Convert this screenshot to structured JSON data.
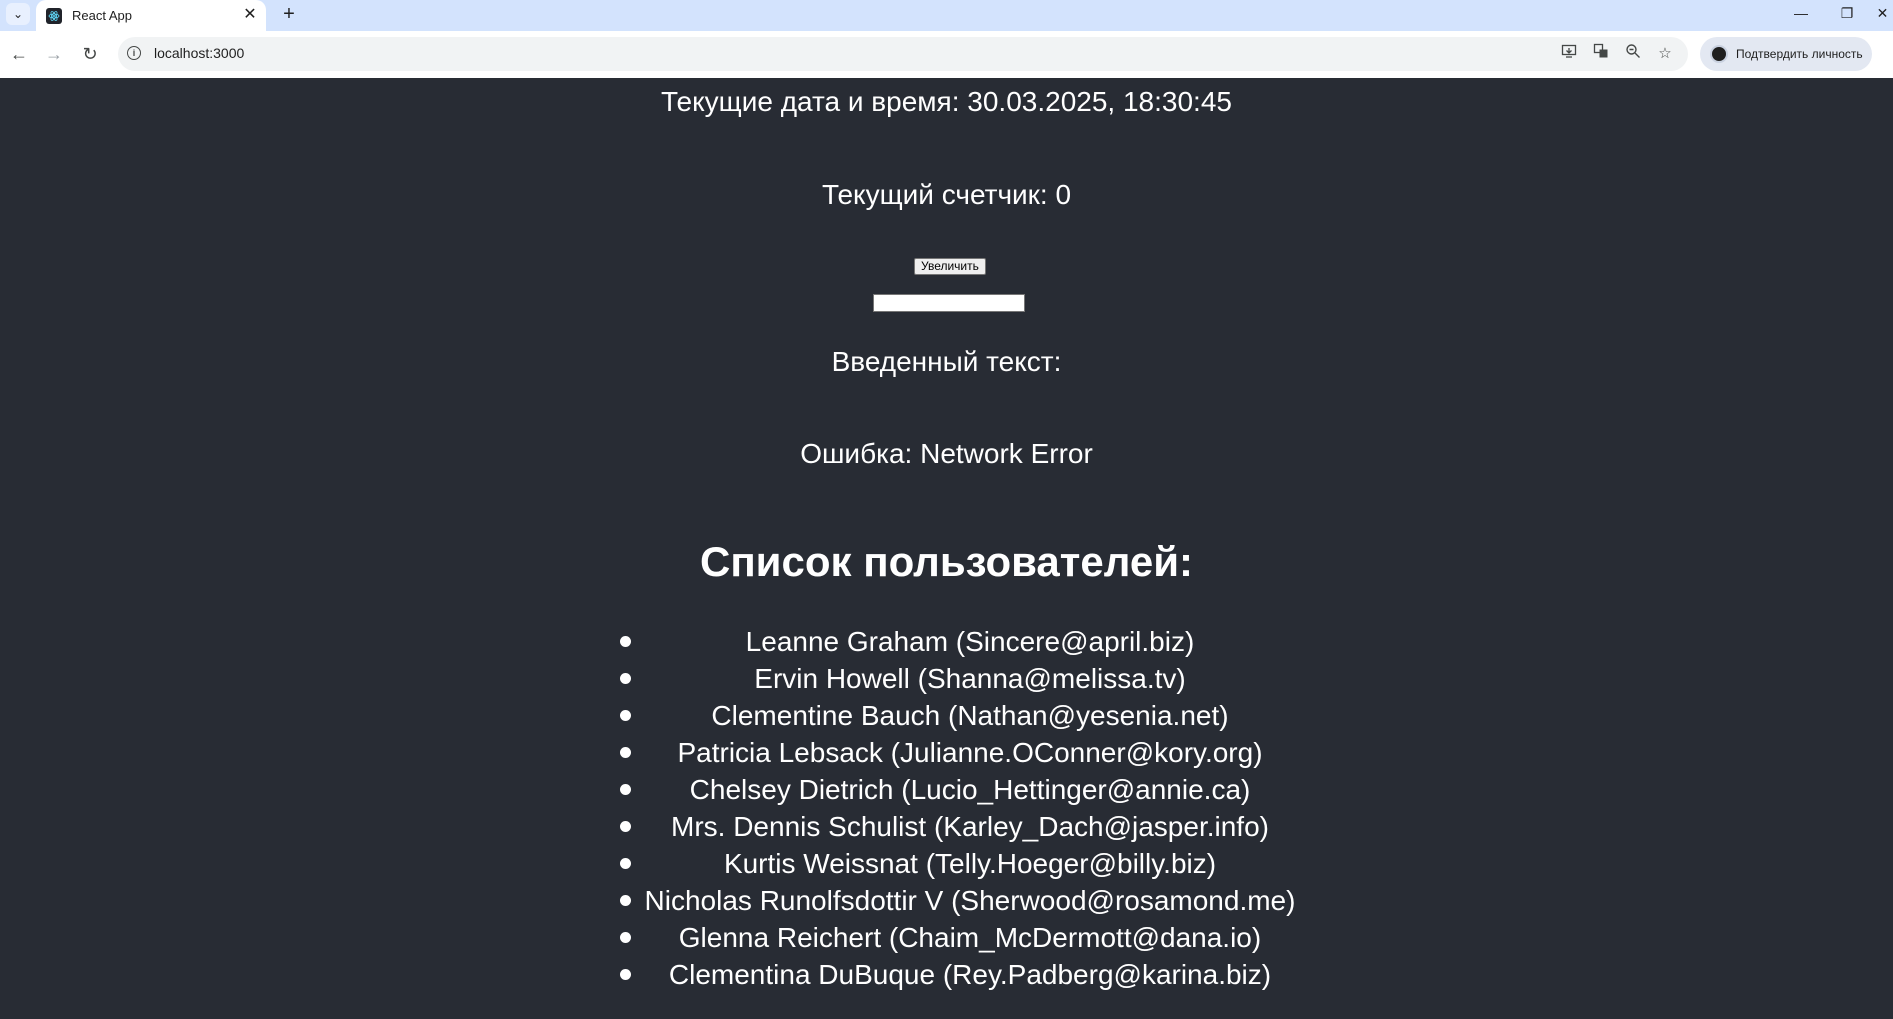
{
  "browser": {
    "tab_title": "React App",
    "tab_close": "✕",
    "new_tab": "+",
    "tab_list": "⌄",
    "window_minimize": "—",
    "window_restore": "❐",
    "window_close": "✕",
    "back": "←",
    "forward": "→",
    "reload": "↻",
    "url": "localhost:3000",
    "profile_label": "Подтвердить личность",
    "icons": [
      "tab-list-icon",
      "react-favicon-icon",
      "back-icon",
      "forward-icon",
      "reload-icon",
      "site-info-icon",
      "install-app-icon",
      "translate-icon",
      "zoom-icon",
      "bookmark-star-icon",
      "avatar-icon"
    ]
  },
  "app": {
    "datetime": "Текущие дата и время: 30.03.2025, 18:30:45",
    "counter": "Текущий счетчик: 0",
    "increment_button": "Увеличить",
    "text_input_value": "",
    "entered_text": "Введенный текст:",
    "error": "Ошибка: Network Error",
    "users_heading": "Список пользователей:",
    "users": [
      "Leanne Graham (Sincere@april.biz)",
      "Ervin Howell (Shanna@melissa.tv)",
      "Clementine Bauch (Nathan@yesenia.net)",
      "Patricia Lebsack (Julianne.OConner@kory.org)",
      "Chelsey Dietrich (Lucio_Hettinger@annie.ca)",
      "Mrs. Dennis Schulist (Karley_Dach@jasper.info)",
      "Kurtis Weissnat (Telly.Hoeger@billy.biz)",
      "Nicholas Runolfsdottir V (Sherwood@rosamond.me)",
      "Glenna Reichert (Chaim_McDermott@dana.io)",
      "Clementina DuBuque (Rey.Padberg@karina.biz)"
    ]
  },
  "colors": {
    "app_background": "#282c34",
    "tabstrip": "#d3e3fd",
    "text": "#ffffff"
  }
}
